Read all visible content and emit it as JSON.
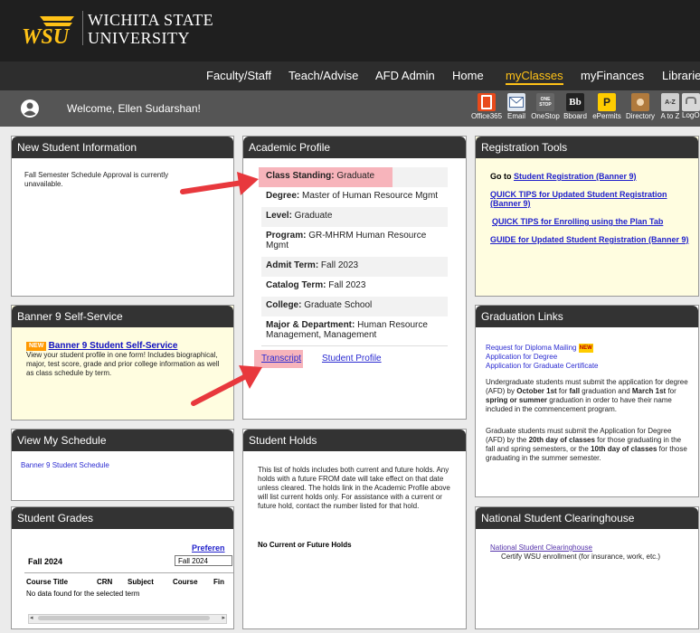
{
  "logo": {
    "mark": "WSU",
    "line1": "WICHITA STATE",
    "line2": "UNIVERSITY"
  },
  "nav": [
    "Faculty/Staff",
    "Teach/Advise",
    "AFD Admin",
    "Home",
    "myClasses",
    "myFinances",
    "Libraries"
  ],
  "welcome": "Welcome, Ellen Sudarshan!",
  "quicklinks": [
    {
      "label": "Office365",
      "icon": "office-icon",
      "color": "#e84a1b"
    },
    {
      "label": "Email",
      "icon": "email-icon",
      "color": "#8a9cb5"
    },
    {
      "label": "OneStop",
      "icon": "onestop-icon",
      "color": "#666666"
    },
    {
      "label": "Bboard",
      "icon": "blackboard-icon",
      "color": "#222222"
    },
    {
      "label": "ePermits",
      "icon": "epermits-icon",
      "color": "#ffcc00"
    },
    {
      "label": "Directory",
      "icon": "directory-icon",
      "color": "#b07a3d"
    },
    {
      "label": "A to Z",
      "icon": "atoz-icon",
      "color": "#cfcfcf"
    },
    {
      "label": "LogO",
      "icon": "lock-icon",
      "color": "#d8d8d8"
    }
  ],
  "onestop_icon_text": "ONE STOP",
  "bboard_icon_text": "Bb",
  "epermits_icon_text": "P",
  "atoz_icon_text": "A-Z",
  "new_student": {
    "title": "New Student Information",
    "text": "Fall Semester Schedule Approval is currently unavailable."
  },
  "banner9": {
    "title": "Banner 9 Self-Service",
    "badge": "NEW",
    "link": "Banner 9 Student Self-Service",
    "text": "View your student profile in one form! Includes biographical, major, test score, grade and prior college information as well as class schedule by term."
  },
  "schedule": {
    "title": "View My Schedule",
    "link": "Banner 9 Student Schedule"
  },
  "grades": {
    "title": "Student Grades",
    "pref": "Preferen",
    "term_label": "Fall 2024",
    "term_select": "Fall 2024",
    "cols": [
      "Course Title",
      "CRN",
      "Subject",
      "Course",
      "Fin"
    ],
    "empty": "No data found for the selected term"
  },
  "profile": {
    "title": "Academic Profile",
    "rows": [
      {
        "label": "Class Standing:",
        "value": " Graduate"
      },
      {
        "label": "Degree:",
        "value": " Master of Human Resource Mgmt"
      },
      {
        "label": "Level:",
        "value": " Graduate"
      },
      {
        "label": "Program:",
        "value": " GR-MHRM Human Resource Mgmt"
      },
      {
        "label": "Admit Term:",
        "value": " Fall 2023"
      },
      {
        "label": "Catalog Term:",
        "value": " Fall 2023"
      },
      {
        "label": "College:",
        "value": " Graduate School"
      },
      {
        "label": "Major & Department:",
        "value": " Human Resource Management, Management"
      }
    ],
    "transcript": "Transcript",
    "student_profile": "Student Profile"
  },
  "holds": {
    "title": "Student Holds",
    "text": "This list of holds includes both current and future holds. Any holds with a future FROM date will take effect on that date unless cleared. The holds link in the Academic Profile above will list current holds only. For assistance with a current or future hold, contact the number listed for that hold.",
    "none": "No Current or Future Holds"
  },
  "registration": {
    "title": "Registration Tools",
    "goto": "Go to ",
    "links": [
      "Student Registration (Banner 9)",
      "QUICK TIPS for Updated Student Registration (Banner 9)",
      "QUICK TIPS for Enrolling using the Plan Tab",
      "GUIDE for Updated Student Registration (Banner 9)"
    ]
  },
  "graduation": {
    "title": "Graduation Links",
    "links": [
      "Request for Diploma Mailing",
      "Application for Degree",
      "Application for Graduate Certificate"
    ],
    "badge": "NEW",
    "p1": {
      "a": "Undergraduate students must submit the application for degree (AFD) by ",
      "b": "October 1st",
      "c": " for ",
      "d": "fall",
      "e": " graduation and ",
      "f": "March 1st",
      "g": " for ",
      "h": "spring or summer",
      "i": " graduation in order to have their name included in the commencement program."
    },
    "p2": {
      "a": "Graduate students must submit the Application for Degree (AFD) by the ",
      "b": "20th day of classes",
      "c": " for those graduating in the fall and spring semesters, or the ",
      "d": "10th day of classes",
      "e": " for those graduating in the summer semester."
    }
  },
  "clearinghouse": {
    "title": "National Student Clearinghouse",
    "link": "National Student Clearinghouse",
    "text": "Certify WSU enrollment (for insurance, work, etc.)"
  }
}
